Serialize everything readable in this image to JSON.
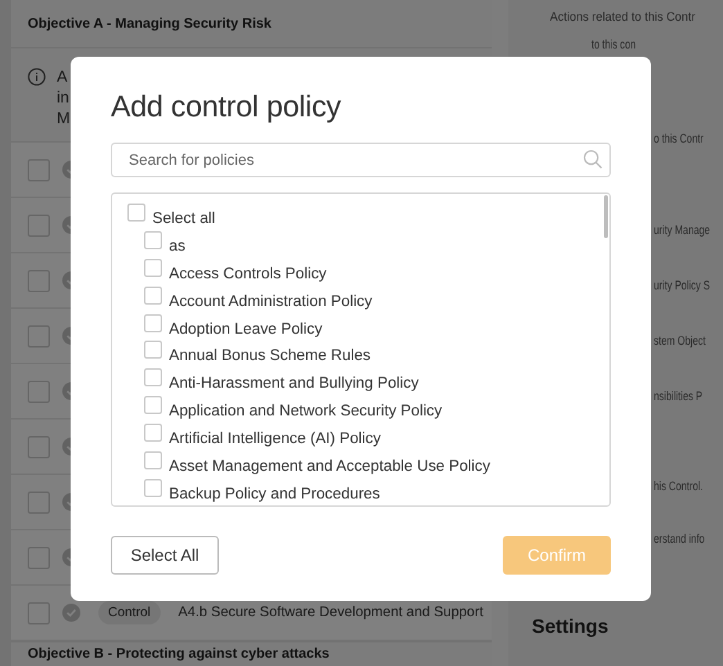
{
  "background": {
    "objective_a": "Objective A - Managing Security Risk",
    "info_lines": [
      "A",
      "in",
      "M"
    ],
    "control_rows": [
      {
        "checked": false
      },
      {
        "checked": false
      },
      {
        "checked": false
      },
      {
        "checked": false
      },
      {
        "checked": false
      },
      {
        "checked": false
      },
      {
        "checked": false
      },
      {
        "checked": false
      },
      {
        "checked": false,
        "tag": "Control",
        "title": "A4.b Secure Software Development and Support"
      }
    ],
    "objective_b": "Objective B - Protecting against cyber attacks",
    "side_texts": [
      "Actions related to this Contr",
      "to this con",
      "o this Contr",
      "urity Manage",
      "urity Policy S",
      "stem Object",
      "nsibilities P",
      "his Control.",
      "erstand info"
    ],
    "settings": "Settings"
  },
  "modal": {
    "title": "Add control policy",
    "search": {
      "placeholder": "Search for policies"
    },
    "select_all": {
      "label": "Select all",
      "checked": false
    },
    "policies": [
      {
        "label": "as",
        "checked": false
      },
      {
        "label": "Access Controls Policy",
        "checked": false
      },
      {
        "label": "Account Administration Policy",
        "checked": false
      },
      {
        "label": "Adoption Leave Policy",
        "checked": false
      },
      {
        "label": "Annual Bonus Scheme Rules",
        "checked": false
      },
      {
        "label": "Anti-Harassment and Bullying Policy",
        "checked": false
      },
      {
        "label": "Application and Network Security Policy",
        "checked": false
      },
      {
        "label": "Artificial Intelligence (AI) Policy",
        "checked": false
      },
      {
        "label": "Asset Management and Acceptable Use Policy",
        "checked": false
      },
      {
        "label": "Backup Policy and Procedures",
        "checked": false
      }
    ],
    "buttons": [
      {
        "label": "Select All",
        "kind": "secondary"
      },
      {
        "label": "Confirm",
        "kind": "primary"
      }
    ]
  }
}
